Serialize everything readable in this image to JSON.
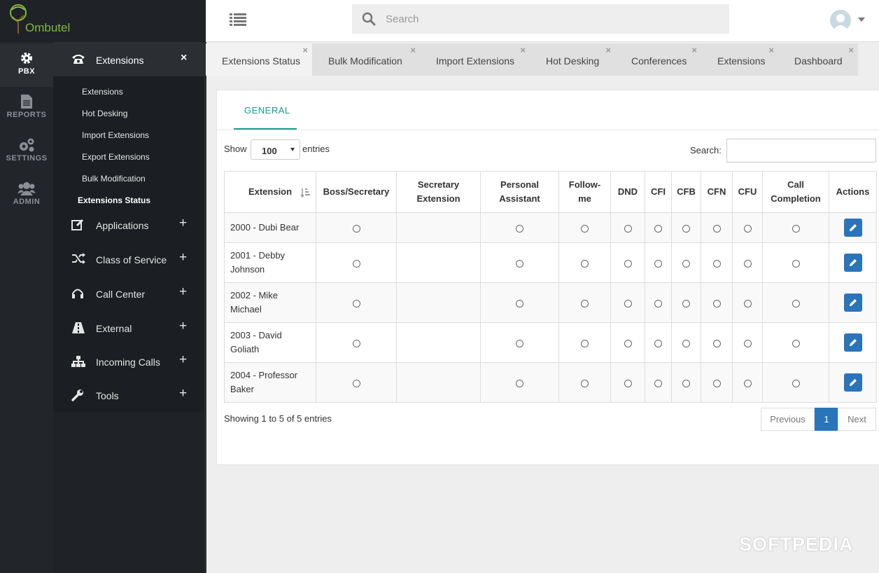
{
  "brand": {
    "name": "Ombutel"
  },
  "rail": [
    {
      "label": "PBX",
      "icon": "gear-icon",
      "active": true
    },
    {
      "label": "REPORTS",
      "icon": "document-icon",
      "active": false
    },
    {
      "label": "SETTINGS",
      "icon": "gears-icon",
      "active": false
    },
    {
      "label": "ADMIN",
      "icon": "users-icon",
      "active": false
    }
  ],
  "submenu": {
    "header": {
      "label": "Extensions",
      "icon": "phone-icon",
      "close": "×"
    },
    "links": [
      "Extensions",
      "Hot Desking",
      "Import Extensions",
      "Export Extensions",
      "Bulk Modification",
      "Extensions Status"
    ],
    "active_link": "Extensions Status",
    "groups": [
      {
        "label": "Applications",
        "icon": "edit-icon",
        "expand": "+"
      },
      {
        "label": "Class of Service",
        "icon": "shuffle-icon",
        "expand": "+"
      },
      {
        "label": "Call Center",
        "icon": "headset-icon",
        "expand": "+"
      },
      {
        "label": "External",
        "icon": "road-icon",
        "expand": "+"
      },
      {
        "label": "Incoming Calls",
        "icon": "sitemap-icon",
        "expand": "+"
      },
      {
        "label": "Tools",
        "icon": "wrench-icon",
        "expand": "+"
      }
    ]
  },
  "topbar": {
    "search_placeholder": "Search"
  },
  "tabs": [
    {
      "label": "Extensions Status",
      "active": true,
      "close": "×"
    },
    {
      "label": "Bulk Modification",
      "active": false,
      "close": "×"
    },
    {
      "label": "Import Extensions",
      "active": false,
      "close": "×"
    },
    {
      "label": "Hot Desking",
      "active": false,
      "close": "×"
    },
    {
      "label": "Conferences",
      "active": false,
      "close": "×"
    },
    {
      "label": "Extensions",
      "active": false,
      "close": "×"
    },
    {
      "label": "Dashboard",
      "active": false,
      "close": "×"
    }
  ],
  "panel": {
    "tab": "GENERAL",
    "show_label": "Show",
    "page_size": "100",
    "entries_label": "entries",
    "search_label": "Search:"
  },
  "table": {
    "columns": [
      [
        "Extension"
      ],
      [
        "Boss/Secretary"
      ],
      [
        "Secretary",
        "Extension"
      ],
      [
        "Personal",
        "Assistant"
      ],
      [
        "Follow-",
        "me"
      ],
      [
        "DND"
      ],
      [
        "CFI"
      ],
      [
        "CFB"
      ],
      [
        "CFN"
      ],
      [
        "CFU"
      ],
      [
        "Call",
        "Completion"
      ],
      [
        "Actions"
      ]
    ],
    "rows": [
      {
        "name": [
          "2000 - Dubi Bear"
        ]
      },
      {
        "name": [
          "2001 - Debby",
          "Johnson"
        ]
      },
      {
        "name": [
          "2002 - Mike",
          "Michael"
        ]
      },
      {
        "name": [
          "2003 - David",
          "Goliath"
        ]
      },
      {
        "name": [
          "2004 - Professor",
          "Baker"
        ]
      }
    ]
  },
  "footer": {
    "info": "Showing 1 to 5 of 5 entries",
    "prev": "Previous",
    "page": "1",
    "next": "Next"
  },
  "watermark": "SOFTPEDIA",
  "colors": {
    "accent": "#1a9a8c",
    "primary": "#2a74b9",
    "logo": "#7fb83b",
    "sidebar": "#22262b"
  }
}
